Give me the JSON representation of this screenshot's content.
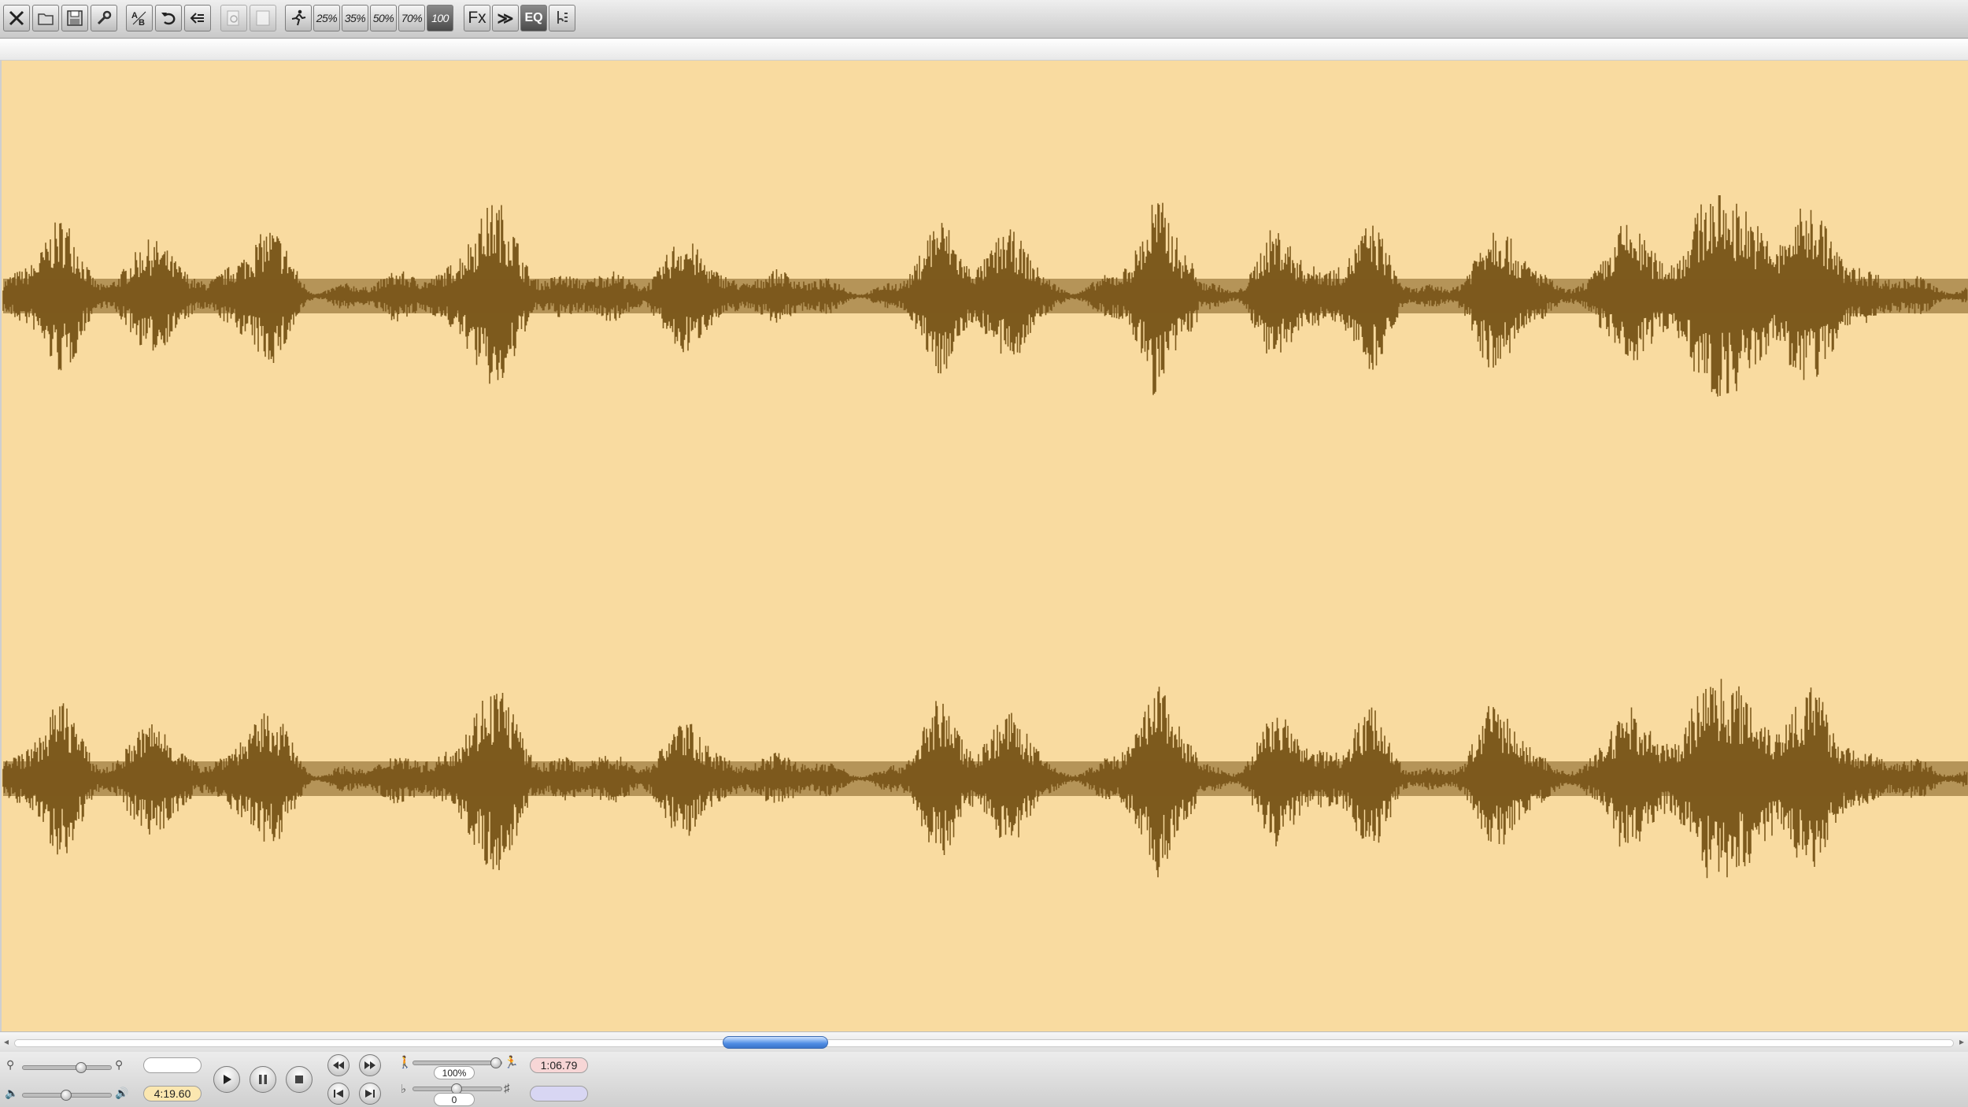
{
  "toolbar": {
    "icons": [
      "close-icon",
      "open-folder-icon",
      "save-icon",
      "wrench-icon",
      "ab-loop-icon",
      "undo-icon",
      "back-icon",
      "preview-icon",
      "blank-icon",
      "runner-icon"
    ],
    "speed_buttons": [
      "25%",
      "35%",
      "50%",
      "70%",
      "100"
    ],
    "fx_label": "Fx",
    "forward_label": "≫",
    "eq_label": "EQ"
  },
  "transport": {
    "total_time": "4:19.60",
    "current_time": "1:06.79",
    "speed_value": "100%",
    "pitch_value": "0",
    "search_value": "",
    "marker_value": ""
  },
  "colors": {
    "background": "#f9dba0",
    "waveform": "#7d5a1d",
    "current_time_pill": "#f7d6d6",
    "total_time_pill": "#fbe7b0",
    "marker_pill": "#d8d6f3"
  },
  "scroll": {
    "position": 0.37
  }
}
